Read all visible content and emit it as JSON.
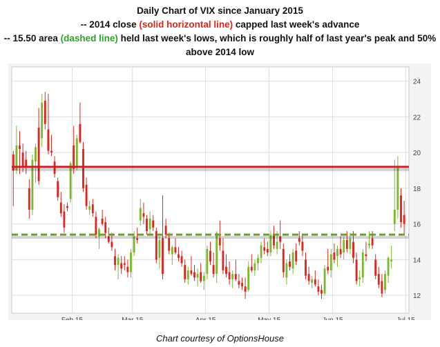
{
  "header": {
    "title": "Daily Chart of VIX since January 2015",
    "line2_prefix": "-- 2014 close ",
    "line2_highlight": "(solid horizontal line)",
    "line2_suffix": " capped last week's advance",
    "line3_prefix": "-- 15.50 area ",
    "line3_highlight": "(dashed line)",
    "line3_suffix": " held last week's lows, which is roughly half of last year's peak and 50%",
    "line4": "above 2014 low"
  },
  "footer": {
    "credit": "Chart courtesy of OptionsHouse"
  },
  "colors": {
    "up": "#7cb82f",
    "down": "#e0241b",
    "resistance": "#c8202a",
    "support": "#6aa123",
    "grid": "#dcdcdc",
    "frame_bg": "#f3f3f3",
    "plot_bg": "#ffffff"
  },
  "chart_data": {
    "type": "candlestick",
    "title": "Daily Chart of VIX since January 2015",
    "y_axis_side": "right",
    "ylim": [
      11,
      24.8
    ],
    "y_ticks": [
      12,
      14,
      16,
      18,
      20,
      22,
      24
    ],
    "x_tick_labels": [
      "Feb 15",
      "Mar 15",
      "Apr 15",
      "May 15",
      "Jun 15",
      "Jul 15"
    ],
    "x_tick_positions": [
      18.5,
      37.5,
      60.5,
      80.5,
      100.5,
      123.5
    ],
    "grid": true,
    "reference_lines": [
      {
        "label": "2014 close",
        "value": 19.2,
        "style": "solid",
        "color": "#c8202a"
      },
      {
        "label": "15.50 area",
        "value": 15.4,
        "style": "dashed",
        "color": "#6aa123"
      }
    ],
    "candles": [
      {
        "o": 19.9,
        "h": 20.1,
        "l": 17.0,
        "c": 19.0
      },
      {
        "o": 19.0,
        "h": 21.5,
        "l": 18.8,
        "c": 20.4
      },
      {
        "o": 20.4,
        "h": 21.2,
        "l": 18.8,
        "c": 20.2
      },
      {
        "o": 20.0,
        "h": 20.5,
        "l": 18.9,
        "c": 19.2
      },
      {
        "o": 19.6,
        "h": 20.1,
        "l": 18.8,
        "c": 19.2
      },
      {
        "o": 18.0,
        "h": 18.5,
        "l": 16.3,
        "c": 16.8
      },
      {
        "o": 16.8,
        "h": 19.9,
        "l": 16.5,
        "c": 19.6
      },
      {
        "o": 19.5,
        "h": 20.5,
        "l": 18.3,
        "c": 20.3
      },
      {
        "o": 21.4,
        "h": 22.5,
        "l": 18.2,
        "c": 18.4
      },
      {
        "o": 20.8,
        "h": 23.3,
        "l": 20.3,
        "c": 22.8
      },
      {
        "o": 22.9,
        "h": 23.4,
        "l": 21.3,
        "c": 21.6
      },
      {
        "o": 21.3,
        "h": 23.3,
        "l": 19.9,
        "c": 20.1
      },
      {
        "o": 20.1,
        "h": 21.0,
        "l": 19.8,
        "c": 20.0
      },
      {
        "o": 19.5,
        "h": 19.8,
        "l": 18.6,
        "c": 18.8
      },
      {
        "o": 18.4,
        "h": 18.6,
        "l": 17.3,
        "c": 17.5
      },
      {
        "o": 17.2,
        "h": 17.8,
        "l": 16.4,
        "c": 16.6
      },
      {
        "o": 16.7,
        "h": 17.1,
        "l": 15.5,
        "c": 15.8
      },
      {
        "o": 17.0,
        "h": 17.2,
        "l": 16.7,
        "c": 16.9
      },
      {
        "o": 17.4,
        "h": 19.5,
        "l": 17.2,
        "c": 19.4
      },
      {
        "o": 20.4,
        "h": 21.5,
        "l": 18.8,
        "c": 19.1
      },
      {
        "o": 19.2,
        "h": 21.0,
        "l": 19.0,
        "c": 20.8
      },
      {
        "o": 21.6,
        "h": 22.8,
        "l": 20.5,
        "c": 20.6
      },
      {
        "o": 20.2,
        "h": 20.6,
        "l": 17.8,
        "c": 18.0
      },
      {
        "o": 18.2,
        "h": 18.6,
        "l": 16.8,
        "c": 17.0
      },
      {
        "o": 16.8,
        "h": 17.3,
        "l": 16.5,
        "c": 17.0
      },
      {
        "o": 17.1,
        "h": 17.4,
        "l": 16.4,
        "c": 16.6
      },
      {
        "o": 16.4,
        "h": 16.7,
        "l": 15.2,
        "c": 15.4
      },
      {
        "o": 15.3,
        "h": 15.8,
        "l": 14.6,
        "c": 15.7
      },
      {
        "o": 16.3,
        "h": 16.8,
        "l": 15.9,
        "c": 16.0
      },
      {
        "o": 16.1,
        "h": 16.4,
        "l": 15.2,
        "c": 15.5
      },
      {
        "o": 15.3,
        "h": 15.8,
        "l": 14.9,
        "c": 15.0
      },
      {
        "o": 15.0,
        "h": 15.5,
        "l": 14.5,
        "c": 14.7
      },
      {
        "o": 14.2,
        "h": 14.6,
        "l": 13.4,
        "c": 13.7
      },
      {
        "o": 13.7,
        "h": 14.3,
        "l": 12.9,
        "c": 14.1
      },
      {
        "o": 13.8,
        "h": 14.2,
        "l": 13.2,
        "c": 13.5
      },
      {
        "o": 13.8,
        "h": 14.2,
        "l": 13.4,
        "c": 13.7
      },
      {
        "o": 13.6,
        "h": 14.0,
        "l": 13.0,
        "c": 13.3
      },
      {
        "o": 13.3,
        "h": 14.6,
        "l": 13.0,
        "c": 14.4
      },
      {
        "o": 14.4,
        "h": 15.6,
        "l": 14.2,
        "c": 15.3
      },
      {
        "o": 15.2,
        "h": 15.8,
        "l": 14.9,
        "c": 15.1
      },
      {
        "o": 16.2,
        "h": 17.4,
        "l": 15.9,
        "c": 16.9
      },
      {
        "o": 16.6,
        "h": 17.2,
        "l": 16.0,
        "c": 16.4
      },
      {
        "o": 16.3,
        "h": 16.5,
        "l": 15.4,
        "c": 15.6
      },
      {
        "o": 15.7,
        "h": 16.7,
        "l": 15.4,
        "c": 16.3
      },
      {
        "o": 16.2,
        "h": 16.5,
        "l": 15.6,
        "c": 15.8
      },
      {
        "o": 15.6,
        "h": 15.8,
        "l": 13.8,
        "c": 14.0
      },
      {
        "o": 14.1,
        "h": 15.3,
        "l": 13.5,
        "c": 15.1
      },
      {
        "o": 15.2,
        "h": 17.6,
        "l": 12.9,
        "c": 13.2
      },
      {
        "o": 15.9,
        "h": 16.3,
        "l": 15.2,
        "c": 15.4
      },
      {
        "o": 15.2,
        "h": 15.5,
        "l": 14.3,
        "c": 14.5
      },
      {
        "o": 14.3,
        "h": 14.8,
        "l": 13.7,
        "c": 14.7
      },
      {
        "o": 14.7,
        "h": 15.2,
        "l": 14.3,
        "c": 14.4
      },
      {
        "o": 14.3,
        "h": 14.7,
        "l": 13.9,
        "c": 14.1
      },
      {
        "o": 14.2,
        "h": 14.5,
        "l": 13.6,
        "c": 13.8
      },
      {
        "o": 13.7,
        "h": 14.0,
        "l": 12.7,
        "c": 12.9
      },
      {
        "o": 12.9,
        "h": 13.6,
        "l": 12.6,
        "c": 13.4
      },
      {
        "o": 13.4,
        "h": 14.2,
        "l": 13.1,
        "c": 13.2
      },
      {
        "o": 13.3,
        "h": 13.7,
        "l": 12.8,
        "c": 13.0
      },
      {
        "o": 13.0,
        "h": 13.5,
        "l": 12.5,
        "c": 13.2
      },
      {
        "o": 13.3,
        "h": 13.8,
        "l": 12.7,
        "c": 12.8
      },
      {
        "o": 12.8,
        "h": 13.3,
        "l": 12.3,
        "c": 13.1
      },
      {
        "o": 13.2,
        "h": 14.8,
        "l": 12.9,
        "c": 14.6
      },
      {
        "o": 14.5,
        "h": 15.0,
        "l": 13.7,
        "c": 13.9
      },
      {
        "o": 13.7,
        "h": 14.4,
        "l": 13.0,
        "c": 13.2
      },
      {
        "o": 13.2,
        "h": 15.6,
        "l": 12.7,
        "c": 15.5
      },
      {
        "o": 15.2,
        "h": 16.2,
        "l": 14.5,
        "c": 14.8
      },
      {
        "o": 14.5,
        "h": 15.2,
        "l": 13.2,
        "c": 13.4
      },
      {
        "o": 13.6,
        "h": 14.3,
        "l": 13.0,
        "c": 13.2
      },
      {
        "o": 13.3,
        "h": 13.9,
        "l": 12.6,
        "c": 12.9
      },
      {
        "o": 12.9,
        "h": 13.4,
        "l": 12.4,
        "c": 13.2
      },
      {
        "o": 13.2,
        "h": 14.0,
        "l": 12.8,
        "c": 12.9
      },
      {
        "o": 12.8,
        "h": 13.2,
        "l": 12.4,
        "c": 12.6
      },
      {
        "o": 12.7,
        "h": 13.0,
        "l": 12.3,
        "c": 12.5
      },
      {
        "o": 12.5,
        "h": 13.0,
        "l": 11.8,
        "c": 12.2
      },
      {
        "o": 12.3,
        "h": 13.9,
        "l": 12.2,
        "c": 13.6
      },
      {
        "o": 13.6,
        "h": 14.3,
        "l": 13.3,
        "c": 13.4
      },
      {
        "o": 13.4,
        "h": 14.0,
        "l": 13.1,
        "c": 13.8
      },
      {
        "o": 13.8,
        "h": 14.3,
        "l": 13.4,
        "c": 14.1
      },
      {
        "o": 14.1,
        "h": 15.0,
        "l": 13.8,
        "c": 14.8
      },
      {
        "o": 14.7,
        "h": 15.2,
        "l": 14.3,
        "c": 14.5
      },
      {
        "o": 14.6,
        "h": 15.0,
        "l": 14.2,
        "c": 14.4
      },
      {
        "o": 14.4,
        "h": 15.6,
        "l": 14.2,
        "c": 15.4
      },
      {
        "o": 15.4,
        "h": 15.9,
        "l": 14.6,
        "c": 14.8
      },
      {
        "o": 14.6,
        "h": 15.6,
        "l": 14.3,
        "c": 15.0
      },
      {
        "o": 15.3,
        "h": 16.2,
        "l": 14.6,
        "c": 15.0
      },
      {
        "o": 14.6,
        "h": 14.9,
        "l": 13.0,
        "c": 13.3
      },
      {
        "o": 13.0,
        "h": 14.0,
        "l": 12.6,
        "c": 13.8
      },
      {
        "o": 13.9,
        "h": 14.3,
        "l": 13.4,
        "c": 13.6
      },
      {
        "o": 13.5,
        "h": 14.6,
        "l": 13.2,
        "c": 14.4
      },
      {
        "o": 14.5,
        "h": 14.9,
        "l": 13.7,
        "c": 13.9
      },
      {
        "o": 15.2,
        "h": 15.6,
        "l": 14.8,
        "c": 15.0
      },
      {
        "o": 15.0,
        "h": 15.4,
        "l": 14.2,
        "c": 14.5
      },
      {
        "o": 14.0,
        "h": 14.4,
        "l": 12.9,
        "c": 13.1
      },
      {
        "o": 13.2,
        "h": 13.6,
        "l": 12.6,
        "c": 12.8
      },
      {
        "o": 12.7,
        "h": 13.1,
        "l": 12.4,
        "c": 12.9
      },
      {
        "o": 12.9,
        "h": 13.4,
        "l": 12.5,
        "c": 12.6
      },
      {
        "o": 12.5,
        "h": 12.9,
        "l": 12.0,
        "c": 12.2
      },
      {
        "o": 12.3,
        "h": 12.6,
        "l": 11.8,
        "c": 12.1
      },
      {
        "o": 12.1,
        "h": 13.7,
        "l": 12.0,
        "c": 13.5
      },
      {
        "o": 13.6,
        "h": 14.6,
        "l": 13.2,
        "c": 13.4
      },
      {
        "o": 13.4,
        "h": 14.6,
        "l": 13.0,
        "c": 14.3
      },
      {
        "o": 14.4,
        "h": 14.9,
        "l": 13.8,
        "c": 14.0
      },
      {
        "o": 14.2,
        "h": 14.8,
        "l": 13.6,
        "c": 14.6
      },
      {
        "o": 14.6,
        "h": 15.3,
        "l": 14.1,
        "c": 14.3
      },
      {
        "o": 14.4,
        "h": 15.3,
        "l": 14.0,
        "c": 15.1
      },
      {
        "o": 15.1,
        "h": 15.6,
        "l": 14.4,
        "c": 14.6
      },
      {
        "o": 14.6,
        "h": 15.5,
        "l": 14.3,
        "c": 15.2
      },
      {
        "o": 15.0,
        "h": 15.6,
        "l": 13.8,
        "c": 14.1
      },
      {
        "o": 14.0,
        "h": 14.4,
        "l": 12.6,
        "c": 12.8
      },
      {
        "o": 12.9,
        "h": 13.4,
        "l": 12.5,
        "c": 13.0
      },
      {
        "o": 13.0,
        "h": 14.6,
        "l": 12.7,
        "c": 14.4
      },
      {
        "o": 14.3,
        "h": 15.0,
        "l": 13.9,
        "c": 14.2
      },
      {
        "o": 14.8,
        "h": 15.6,
        "l": 14.6,
        "c": 14.9
      },
      {
        "o": 15.2,
        "h": 15.6,
        "l": 14.6,
        "c": 14.8
      },
      {
        "o": 14.0,
        "h": 14.3,
        "l": 12.9,
        "c": 13.1
      },
      {
        "o": 13.2,
        "h": 13.6,
        "l": 12.4,
        "c": 12.6
      },
      {
        "o": 12.8,
        "h": 13.2,
        "l": 11.9,
        "c": 12.1
      },
      {
        "o": 12.3,
        "h": 13.4,
        "l": 12.1,
        "c": 13.2
      },
      {
        "o": 13.1,
        "h": 14.2,
        "l": 12.7,
        "c": 14.1
      },
      {
        "o": 13.9,
        "h": 14.8,
        "l": 13.5,
        "c": 14.0
      },
      {
        "o": 16.0,
        "h": 19.6,
        "l": 15.6,
        "c": 16.8
      },
      {
        "o": 16.8,
        "h": 19.8,
        "l": 16.3,
        "c": 19.2
      },
      {
        "o": 17.6,
        "h": 18.0,
        "l": 15.8,
        "c": 16.1
      },
      {
        "o": 16.5,
        "h": 17.3,
        "l": 15.4,
        "c": 16.0
      }
    ]
  }
}
